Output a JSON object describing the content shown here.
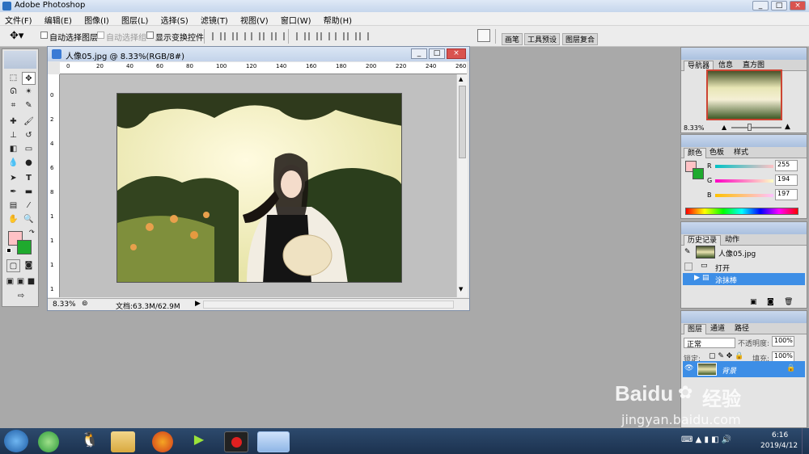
{
  "app": {
    "title": "Adobe Photoshop",
    "window_buttons": [
      "_",
      "□",
      "×"
    ]
  },
  "menu": [
    "文件(F)",
    "编辑(E)",
    "图像(I)",
    "图层(L)",
    "选择(S)",
    "滤镜(T)",
    "视图(V)",
    "窗口(W)",
    "帮助(H)"
  ],
  "options_bar": {
    "auto_select_layer": "自动选择图层",
    "auto_select_group": "自动选择组",
    "show_transform": "显示变换控件",
    "right_tabs": [
      "画笔",
      "工具预设",
      "图层复合"
    ]
  },
  "document": {
    "title": "人像05.jpg @ 8.33%(RGB/8#)",
    "zoom": "8.33%",
    "doc_size": "文档:63.3M/62.9M",
    "ruler_top": [
      "0",
      "20",
      "40",
      "60",
      "80",
      "100",
      "120",
      "140",
      "160",
      "180",
      "200",
      "220",
      "240",
      "260"
    ],
    "ruler_left": [
      "0",
      "2",
      "4",
      "6",
      "8",
      "1",
      "1",
      "1",
      "1"
    ]
  },
  "navigator": {
    "tabs": [
      "导航器",
      "信息",
      "直方图"
    ],
    "zoom": "8.33%"
  },
  "color": {
    "tabs": [
      "颜色",
      "色板",
      "样式"
    ],
    "r_label": "R",
    "g_label": "G",
    "b_label": "B",
    "r": 255,
    "g": 194,
    "b": 197,
    "fg_color": "#ffc2c5",
    "bg_color": "#1faa2e"
  },
  "history": {
    "tabs": [
      "历史记录",
      "动作"
    ],
    "snapshot": "人像05.jpg",
    "items": [
      "打开",
      "涂抹棒"
    ]
  },
  "layers": {
    "tabs": [
      "图层",
      "通道",
      "路径"
    ],
    "blend_mode": "正常",
    "opacity_label": "不透明度:",
    "opacity": "100%",
    "lock_label": "锁定:",
    "fill_label": "填充:",
    "fill": "100%",
    "layer_name": "背景"
  },
  "taskbar": {
    "time": "6:16",
    "date": "2019/4/12"
  },
  "watermark": {
    "brand": "Baidu",
    "product": "经验",
    "url": "jingyan.baidu.com"
  }
}
